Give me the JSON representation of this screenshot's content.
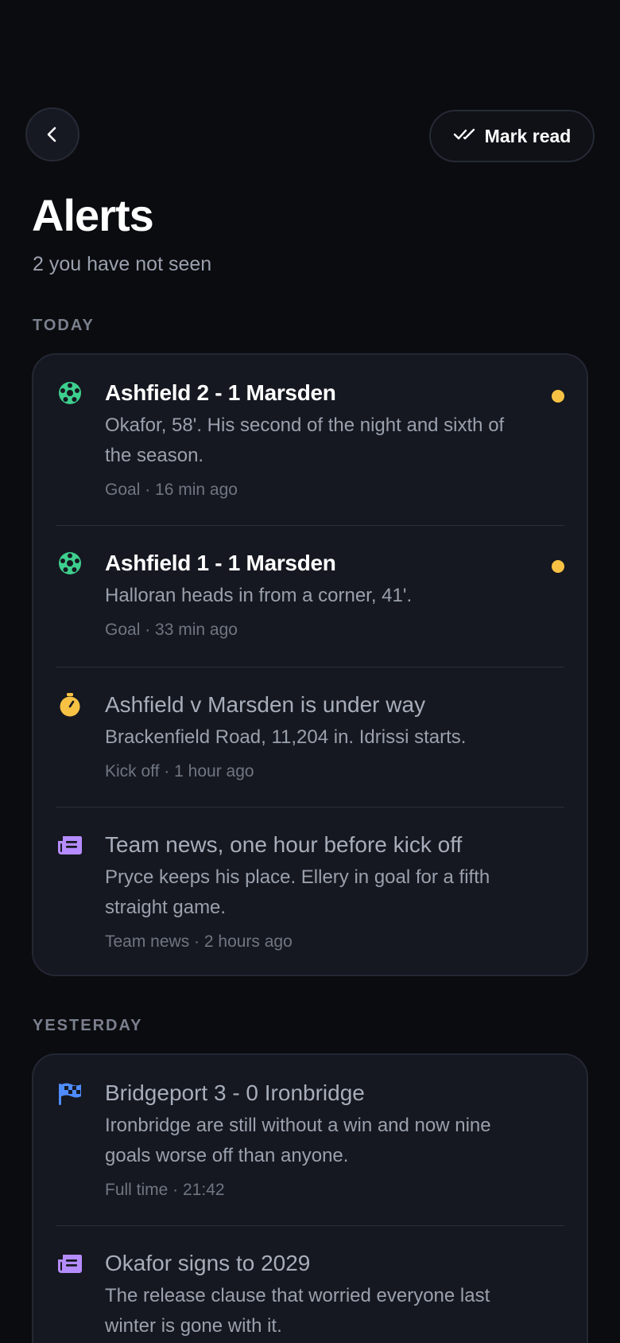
{
  "colors": {
    "background": "#0b0c10",
    "card": "#151820",
    "unread_dot": "#f7c244",
    "goal_icon": "#3ecf8e",
    "kickoff_icon": "#f7c244",
    "news_icon": "#b58cff",
    "fulltime_icon": "#4f8cff"
  },
  "header": {
    "back_icon": "chevron-left-icon",
    "mark_read_icon": "double-check-icon",
    "mark_read_label": "Mark read"
  },
  "page": {
    "title": "Alerts",
    "subtitle": "2 you have not seen"
  },
  "sections": [
    {
      "label": "TODAY",
      "items": [
        {
          "icon": "football-icon",
          "unread": true,
          "title": "Ashfield 2 - 1 Marsden",
          "body": "Okafor, 58'. His second of the night and sixth of the season.",
          "meta": "Goal · 16 min ago"
        },
        {
          "icon": "football-icon",
          "unread": true,
          "title": "Ashfield 1 - 1 Marsden",
          "body": "Halloran heads in from a corner, 41'.",
          "meta": "Goal · 33 min ago"
        },
        {
          "icon": "stopwatch-icon",
          "unread": false,
          "title": "Ashfield v Marsden is under way",
          "body": "Brackenfield Road, 11,204 in. Idrissi starts.",
          "meta": "Kick off · 1 hour ago"
        },
        {
          "icon": "newspaper-icon",
          "unread": false,
          "title": "Team news, one hour before kick off",
          "body": "Pryce keeps his place. Ellery in goal for a fifth straight game.",
          "meta": "Team news · 2 hours ago"
        }
      ]
    },
    {
      "label": "YESTERDAY",
      "items": [
        {
          "icon": "checkered-flag-icon",
          "unread": false,
          "title": "Bridgeport 3 - 0 Ironbridge",
          "body": "Ironbridge are still without a win and now nine goals worse off than anyone.",
          "meta": "Full time · 21:42"
        },
        {
          "icon": "newspaper-icon",
          "unread": false,
          "title": "Okafor signs to 2029",
          "body": "The release clause that worried everyone last winter is gone with it.",
          "meta": ""
        }
      ]
    }
  ]
}
